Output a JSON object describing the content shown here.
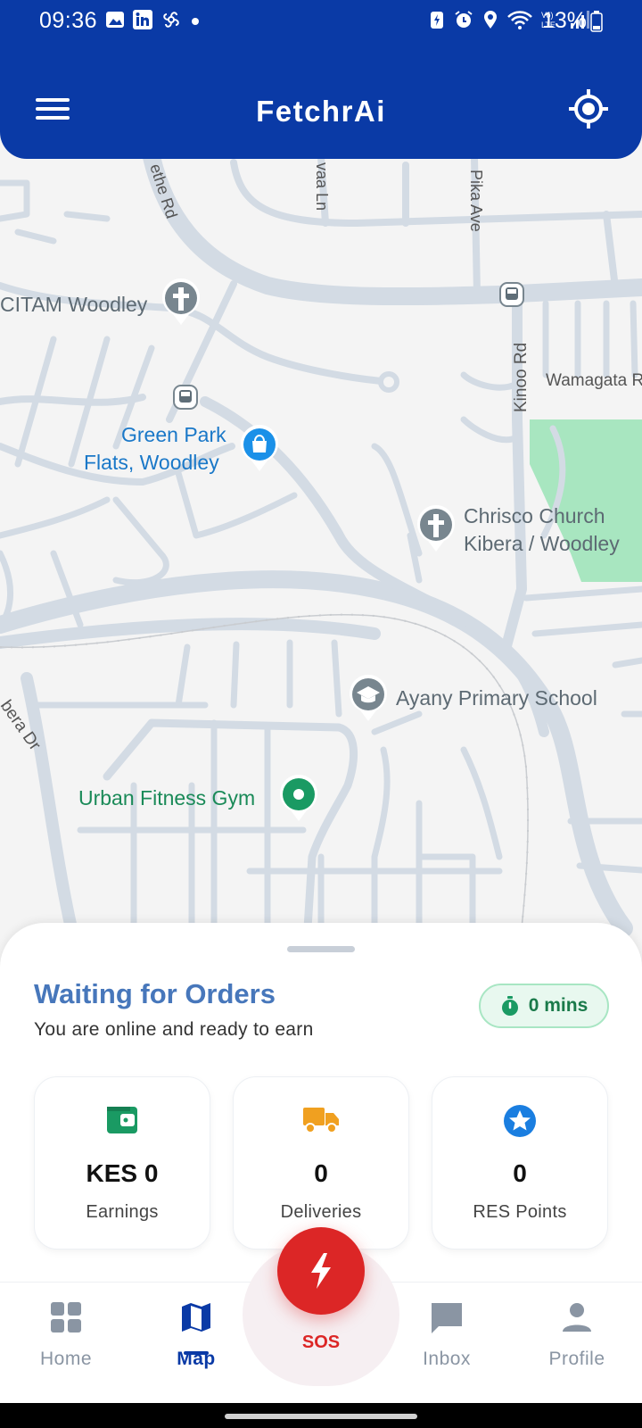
{
  "status_bar": {
    "time": "09:36",
    "battery": "13%",
    "left_icons": [
      "gallery-icon",
      "linkedin-icon",
      "pinwheel-icon",
      "dot-icon"
    ],
    "right_icons": [
      "battery-saver-icon",
      "alarm-icon",
      "location-icon",
      "wifi-icon",
      "volte-icon",
      "signal-icon",
      "battery-icon"
    ]
  },
  "header": {
    "title": "FetchrAi",
    "menu_icon": "hamburger-menu-icon",
    "locate_icon": "my-location-icon"
  },
  "map": {
    "labels": {
      "citam": "CITAM Woodley",
      "green_park_1": "Green Park",
      "green_park_2": "Flats, Woodley",
      "chrisco_1": "Chrisco Church",
      "chrisco_2": "Kibera / Woodley",
      "ayany": "Ayany Primary School",
      "gym": "Urban Fitness Gym",
      "wamagata": "Wamagata R",
      "kinoo": "Kinoo Rd",
      "pika": "Pika Ave",
      "ethe": "ethe Rd",
      "vaa": "vaa Ln",
      "bera": "bera Dr"
    },
    "colors": {
      "road": "#d3dbe4",
      "park": "#a8e6c0",
      "church_pin": "#78868f",
      "shop_pin": "#1a90e8",
      "gym_pin": "#1a9a63"
    }
  },
  "sheet": {
    "title": "Waiting for Orders",
    "subtitle": "You are online and ready to earn",
    "timer": "0 mins",
    "stats": [
      {
        "icon": "wallet-icon",
        "value": "KES 0",
        "label": "Earnings",
        "color": "#1a9a63"
      },
      {
        "icon": "truck-icon",
        "value": "0",
        "label": "Deliveries",
        "color": "#f0a020"
      },
      {
        "icon": "star-badge-icon",
        "value": "0",
        "label": "RES Points",
        "color": "#1a7ee0"
      }
    ]
  },
  "nav": {
    "home": "Home",
    "map": "Map",
    "sos": "SOS",
    "inbox": "Inbox",
    "profile": "Profile",
    "active": "Map"
  }
}
